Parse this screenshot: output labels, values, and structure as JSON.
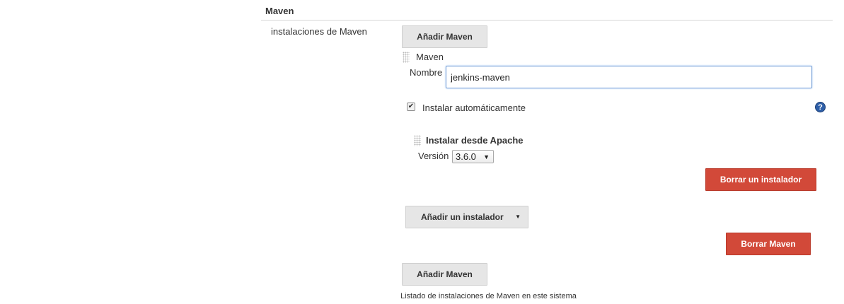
{
  "section": {
    "title": "Maven"
  },
  "row": {
    "label": "instalaciones de Maven"
  },
  "buttons": {
    "add_maven": "Añadir Maven",
    "add_installer": "Añadir un instalador",
    "delete_installer": "Borrar un instalador",
    "delete_maven": "Borrar Maven"
  },
  "maven_block": {
    "name": "Maven",
    "nombre_label": "Nombre",
    "nombre_value": "jenkins-maven",
    "auto_install_label": "Instalar automáticamente",
    "auto_install_checked": true
  },
  "installer": {
    "title": "Instalar desde Apache",
    "version_label": "Versión",
    "version_value": "3.6.0"
  },
  "footnote": "Listado de instalaciones de Maven en este sistema",
  "icons": {
    "help": "help-icon",
    "grip": "drag-handle-icon",
    "dropdown": "caret-down-icon"
  },
  "colors": {
    "danger": "#d24939",
    "neutral_button": "#e6e6e6",
    "help": "#2e5fa8"
  }
}
